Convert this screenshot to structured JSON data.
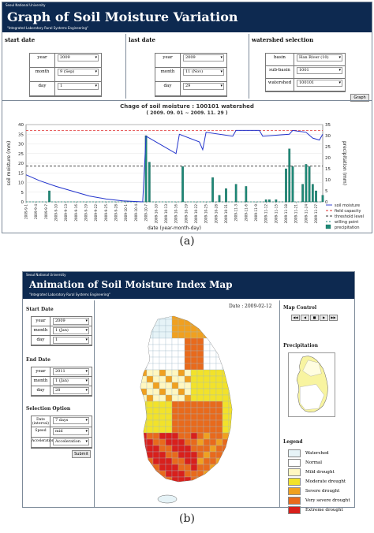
{
  "panel_a": {
    "header": {
      "university": "Seoul  National University",
      "title": "Graph of Soil Moisture Variation",
      "subtitle": "\"Integrated Laboratory Rural Systems Engineering\""
    },
    "start_date": {
      "label": "start date",
      "year_label": "year",
      "year": "2009",
      "month_label": "month",
      "month": "9 (Sep)",
      "day_label": "day",
      "day": "1"
    },
    "last_date": {
      "label": "last date",
      "year_label": "year",
      "year": "2009",
      "month_label": "month",
      "month": "11 (Nov)",
      "day_label": "day",
      "day": "29"
    },
    "watershed": {
      "label": "watershed selection",
      "basin_label": "basin",
      "basin": "Han River (10)",
      "subbasin_label": "sub-basin",
      "subbasin": "1001",
      "watershed_label": "watershed",
      "watershed": "100101"
    },
    "graph_button": "Graph",
    "caption": "(a)"
  },
  "chart_data": {
    "type": "line",
    "title": "Chage of soil moisture : 100101 watershed",
    "subtitle": "( 2009. 09. 01 ~ 2009. 11. 29 )",
    "xlabel": "date (year-month-day)",
    "ylabel": "soil moisture (mm)",
    "y2label": "precipitation (mm)",
    "ylim": [
      0,
      40
    ],
    "y2lim": [
      0,
      35
    ],
    "yticks": [
      "0",
      "5",
      "10",
      "15",
      "20",
      "25",
      "30",
      "35",
      "40"
    ],
    "y2ticks": [
      "0",
      "5",
      "10",
      "15",
      "20",
      "25",
      "30",
      "35"
    ],
    "x_tick_labels": [
      "2009-9-1",
      "2009-9-4",
      "2009-9-7",
      "2009-9-10",
      "2009-9-13",
      "2009-9-16",
      "2009-9-19",
      "2009-9-22",
      "2009-9-25",
      "2009-9-28",
      "2009-10-1",
      "2009-10-4",
      "2009-10-7",
      "2009-10-10",
      "2009-10-13",
      "2009-10-16",
      "2009-10-19",
      "2009-10-22",
      "2009-10-25",
      "2009-10-28",
      "2009-10-31",
      "2009-11-3",
      "2009-11-6",
      "2009-11-9",
      "2009-11-12",
      "2009-11-15",
      "2009-11-18",
      "2009-11-21",
      "2009-11-24",
      "2009-11-27"
    ],
    "field_capacity": 37,
    "threshold_level": 18.5,
    "wilting_point": 0,
    "series": [
      {
        "name": "soil moisture",
        "color": "#2233cc",
        "x": [
          1,
          5,
          10,
          15,
          20,
          25,
          30,
          36,
          37,
          42,
          46,
          47,
          53,
          54,
          55,
          63,
          64,
          71,
          72,
          80,
          81,
          85,
          87,
          89,
          90
        ],
        "y": [
          14,
          11,
          8,
          5.5,
          3,
          1.5,
          0.5,
          0,
          34,
          29,
          25,
          35,
          31,
          27,
          36,
          34,
          37,
          37,
          34,
          35,
          37,
          36,
          33,
          32,
          35
        ]
      },
      {
        "name": "precipitation",
        "type": "bar",
        "color": "#1e8a78",
        "x": [
          8,
          37,
          38,
          48,
          57,
          59,
          61,
          64,
          67,
          73,
          74,
          76,
          79,
          80,
          81,
          84,
          85,
          86,
          87,
          88,
          90
        ],
        "y": [
          5,
          30,
          18,
          16,
          11,
          3,
          6,
          8,
          7,
          1,
          1,
          1,
          15,
          24,
          16,
          8,
          17,
          16,
          8,
          5,
          3
        ]
      }
    ],
    "legend": [
      "soil moisture",
      "field capacity",
      "threshold level",
      "willing point",
      "precipitation"
    ],
    "legend_position": "bottom-right"
  },
  "panel_b": {
    "header": {
      "university": "Seoul  National University",
      "title": "Animation of Soil Moisture Index Map",
      "subtitle": "\"Integrated Laboratory Rural Systems Engineering\""
    },
    "start_date": {
      "label": "Start Date",
      "year_label": "year",
      "year": "2009",
      "month_label": "month",
      "month": "1 (Jan)",
      "day_label": "day",
      "day": "1"
    },
    "end_date": {
      "label": "End Date",
      "year_label": "year",
      "year": "2011",
      "month_label": "month",
      "month": "1 (Jan)",
      "day_label": "day",
      "day": "28"
    },
    "selection": {
      "label": "Selection Option",
      "interval_label": "Date (interval)",
      "interval": "7 days",
      "speed_label": "Speed",
      "speed": "mid",
      "acceleration_label": "Acceleration",
      "acceleration": "Acceleration"
    },
    "submit_button": "Submit",
    "date_label": "Date :",
    "date_value": "2009-02-12",
    "map_control_label": "Map Control",
    "map_controls": [
      "◀◀",
      "◀",
      "■",
      "▶",
      "▶▶"
    ],
    "precipitation_label": "Precipitation",
    "legend_label": "Legend",
    "legend": [
      {
        "label": "Watershed",
        "color": "#e6f3f7"
      },
      {
        "label": "Normal",
        "color": "#ffffff"
      },
      {
        "label": "Mild drought",
        "color": "#fff7c0"
      },
      {
        "label": "Moderate drought",
        "color": "#f2e22a"
      },
      {
        "label": "Severe drought",
        "color": "#f0a020"
      },
      {
        "label": "Very severe drought",
        "color": "#e86a1c"
      },
      {
        "label": "Extreme drought",
        "color": "#d8201c"
      }
    ],
    "caption": "(b)"
  }
}
